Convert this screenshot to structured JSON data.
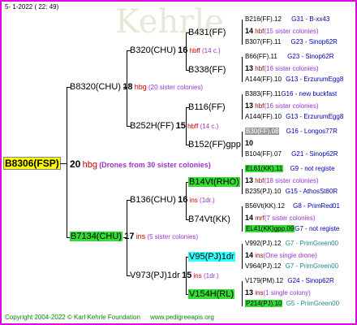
{
  "date": "5- 1-2022 ( 22: 49)",
  "root": {
    "name": "B8306(FSP)",
    "year": "20",
    "note": "hbg",
    "extra": "(Drones from 30 sister colonies)"
  },
  "g1": [
    {
      "name": "B8320(CHU)",
      "year": "18",
      "note": "hbg",
      "extra": "(20 sister colonies)"
    },
    {
      "name": "B7134(CHU)",
      "year": "17",
      "note": "ins",
      "extra": "(5 sister colonies)"
    }
  ],
  "g2": [
    {
      "name": "B320(CHU)",
      "year": "16",
      "note": "hbff",
      "extra": "(14 c.)"
    },
    {
      "name": "B252H(FF)",
      "year": "15",
      "note": "hbff",
      "extra": "(14 c.)"
    },
    {
      "name": "B136(CHU)",
      "year": "16",
      "note": "ins",
      "extra": "(1dr.)"
    },
    {
      "name": "V973(PJ)1dr",
      "year": "15",
      "note": "ins",
      "extra": "(1dr.)"
    }
  ],
  "g3": [
    {
      "name": "B431(FF)"
    },
    {
      "name": "B338(FF)"
    },
    {
      "name": "B116(FF)"
    },
    {
      "name": "B152(FF)gpp"
    },
    {
      "name": "B14Vt(RHO)"
    },
    {
      "name": "B74Vt(KK)"
    },
    {
      "name": "V95(PJ)1dr"
    },
    {
      "name": "V154H(RL)"
    }
  ],
  "g4": [
    {
      "top": "B216(FF).12",
      "topsrc": "G31 - B-xx43",
      "year": "14",
      "note": "hbf",
      "extra": "(15 sister colonies)",
      "bot": "B307(FF).11",
      "botsrc": "G23 - Sinop62R"
    },
    {
      "top": "B66(FF).11",
      "topsrc": "G23 - Sinop62R",
      "year": "13",
      "note": "hbf",
      "extra": "(16 sister colonies)",
      "bot": "A144(FF).10",
      "botsrc": "G13 - ErzurumEgg8"
    },
    {
      "top": "B383(FF).11",
      "topsrc": "G16 - new buckfast",
      "year": "13",
      "note": "hbf",
      "extra": "(16 sister colonies)",
      "bot": "A144(FF).10",
      "botsrc": "G13 - ErzurumEgg8"
    },
    {
      "top": "B30(FF).08",
      "topsrc": "G16 - Longos77R",
      "year": "10",
      "note": "",
      "extra": "",
      "bot": "B104(FF).07",
      "botsrc": "G21 - Sinop62R"
    },
    {
      "top": "EL61(KK).11",
      "topsrc": "G9 - not registe",
      "year": "13",
      "note": "hbf",
      "extra": "(18 sister colonies)",
      "bot": "B235(PJ).10",
      "botsrc": "G15 - AthosSt80R"
    },
    {
      "top": "B56Vt(KK).12",
      "topsrc": "G8 - PrimRed01",
      "year": "14",
      "note": "mrf",
      "extra": "(7 sister colonies)",
      "bot": "EL41(KK)gpp.09",
      "botsrc": "G7 - not registe"
    },
    {
      "top": "V992(PJ).12",
      "topsrc": "G7 - PrimGreen00",
      "year": "14",
      "note": "ins",
      "extra": "(One single drone)",
      "bot": "V964(PJ).12",
      "botsrc": "G7 - PrimGreen00"
    },
    {
      "top": "V179(PM).12",
      "topsrc": "G24 - Sinop62R",
      "year": "13",
      "note": "ins",
      "extra": "(1 single colony)",
      "bot": "P214(PJ).10",
      "botsrc": "G5 - PrimGreen00"
    }
  ],
  "footer": {
    "copyright": "Copyright 2004-2022 © Karl Kehrle Foundation",
    "site": "www.pedigreeapis.org"
  }
}
